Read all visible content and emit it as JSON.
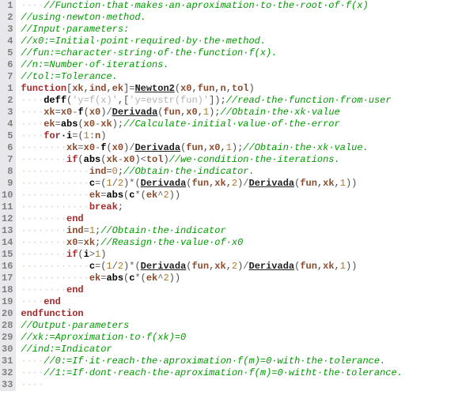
{
  "gutter": [
    "1",
    "2",
    "3",
    "4",
    "5",
    "6",
    "7",
    "1",
    "2",
    "3",
    "4",
    "5",
    "6",
    "7",
    "8",
    "9",
    "10",
    "11",
    "12",
    "13",
    "14",
    "15",
    "16",
    "17",
    "18",
    "19",
    "20",
    "28",
    "29",
    "30",
    "31",
    "32",
    "33"
  ],
  "lines": [
    [
      [
        "ws",
        "····"
      ],
      [
        "c-comment",
        "//Function·that·makes·an·aproximation·to·the·root·of·f(x)"
      ]
    ],
    [
      [
        "c-comment",
        "//using·newton·method."
      ]
    ],
    [
      [
        "c-comment",
        "//Input·parameters:"
      ]
    ],
    [
      [
        "c-comment",
        "//x0:=Initial·point·required·by·the·method."
      ]
    ],
    [
      [
        "c-comment",
        "//fun:=character·string·of·the·function·f(x)."
      ]
    ],
    [
      [
        "c-comment",
        "//n:=Number·of·iterations."
      ]
    ],
    [
      [
        "c-comment",
        "//tol:=Tolerance."
      ]
    ],
    [
      [
        "c-kw",
        "function"
      ],
      [
        "c-punct",
        "["
      ],
      [
        "c-var",
        "xk"
      ],
      [
        "c-punct",
        ","
      ],
      [
        "c-var",
        "ind"
      ],
      [
        "c-punct",
        ","
      ],
      [
        "c-var",
        "ek"
      ],
      [
        "c-punct",
        "]"
      ],
      [
        "c-op",
        "="
      ],
      [
        "c-fn",
        "Newton2"
      ],
      [
        "c-punct",
        "("
      ],
      [
        "c-var",
        "x0"
      ],
      [
        "c-punct",
        ","
      ],
      [
        "c-var",
        "fun"
      ],
      [
        "c-punct",
        ","
      ],
      [
        "c-var",
        "n"
      ],
      [
        "c-punct",
        ","
      ],
      [
        "c-var",
        "tol"
      ],
      [
        "c-punct",
        ")"
      ]
    ],
    [
      [
        "ws",
        "····"
      ],
      [
        "c-id",
        "deff"
      ],
      [
        "c-punct",
        "("
      ],
      [
        "c-str",
        "'y=f(x)'"
      ],
      [
        "c-punct",
        ","
      ],
      [
        "c-punct",
        "["
      ],
      [
        "c-str",
        "'y=evstr(fun)'"
      ],
      [
        "c-punct",
        "]"
      ],
      [
        "c-punct",
        ")"
      ],
      [
        "c-punct",
        ";"
      ],
      [
        "c-comment",
        "//read·the·function·from·user"
      ]
    ],
    [
      [
        "ws",
        "····"
      ],
      [
        "c-var",
        "xk"
      ],
      [
        "c-op",
        "="
      ],
      [
        "c-var",
        "x0"
      ],
      [
        "c-op",
        "-"
      ],
      [
        "c-id",
        "f"
      ],
      [
        "c-punct",
        "("
      ],
      [
        "c-var",
        "x0"
      ],
      [
        "c-punct",
        ")"
      ],
      [
        "c-op",
        "/"
      ],
      [
        "c-fn",
        "Derivada"
      ],
      [
        "c-punct",
        "("
      ],
      [
        "c-var",
        "fun"
      ],
      [
        "c-punct",
        ","
      ],
      [
        "c-var",
        "x0"
      ],
      [
        "c-punct",
        ","
      ],
      [
        "c-num",
        "1"
      ],
      [
        "c-punct",
        ")"
      ],
      [
        "c-punct",
        ";"
      ],
      [
        "c-comment",
        "//Obtain·the·xk·value"
      ]
    ],
    [
      [
        "ws",
        "····"
      ],
      [
        "c-var",
        "ek"
      ],
      [
        "c-op",
        "="
      ],
      [
        "c-id",
        "abs"
      ],
      [
        "c-punct",
        "("
      ],
      [
        "c-var",
        "x0"
      ],
      [
        "c-op",
        "-"
      ],
      [
        "c-var",
        "xk"
      ],
      [
        "c-punct",
        ")"
      ],
      [
        "c-punct",
        ";"
      ],
      [
        "c-comment",
        "//Calculate·initial·value·of·the·error"
      ]
    ],
    [
      [
        "ws",
        "····"
      ],
      [
        "c-kw",
        "for"
      ],
      [
        "c-id",
        "·i"
      ],
      [
        "c-op",
        "="
      ],
      [
        "c-punct",
        "("
      ],
      [
        "c-num",
        "1"
      ],
      [
        "c-op",
        ":"
      ],
      [
        "c-var",
        "n"
      ],
      [
        "c-punct",
        ")"
      ]
    ],
    [
      [
        "ws",
        "········"
      ],
      [
        "c-var",
        "xk"
      ],
      [
        "c-op",
        "="
      ],
      [
        "c-var",
        "x0"
      ],
      [
        "c-op",
        "-"
      ],
      [
        "c-id",
        "f"
      ],
      [
        "c-punct",
        "("
      ],
      [
        "c-var",
        "x0"
      ],
      [
        "c-punct",
        ")"
      ],
      [
        "c-op",
        "/"
      ],
      [
        "c-fn",
        "Derivada"
      ],
      [
        "c-punct",
        "("
      ],
      [
        "c-var",
        "fun"
      ],
      [
        "c-punct",
        ","
      ],
      [
        "c-var",
        "x0"
      ],
      [
        "c-punct",
        ","
      ],
      [
        "c-num",
        "1"
      ],
      [
        "c-punct",
        ")"
      ],
      [
        "c-punct",
        ";"
      ],
      [
        "c-comment",
        "//Obtain·the·xk·value."
      ]
    ],
    [
      [
        "ws",
        "········"
      ],
      [
        "c-kw",
        "if"
      ],
      [
        "c-punct",
        "("
      ],
      [
        "c-id",
        "abs"
      ],
      [
        "c-punct",
        "("
      ],
      [
        "c-var",
        "xk"
      ],
      [
        "c-op",
        "-"
      ],
      [
        "c-var",
        "x0"
      ],
      [
        "c-punct",
        ")"
      ],
      [
        "c-op",
        "<"
      ],
      [
        "c-var",
        "tol"
      ],
      [
        "c-punct",
        ")"
      ],
      [
        "c-comment",
        "//we·condition·the·iterations."
      ]
    ],
    [
      [
        "ws",
        "············"
      ],
      [
        "c-var",
        "ind"
      ],
      [
        "c-op",
        "="
      ],
      [
        "c-num",
        "0"
      ],
      [
        "c-punct",
        ";"
      ],
      [
        "c-comment",
        "//Obtain·the·indicator."
      ]
    ],
    [
      [
        "ws",
        "············"
      ],
      [
        "c-id",
        "c"
      ],
      [
        "c-op",
        "="
      ],
      [
        "c-punct",
        "("
      ],
      [
        "c-num",
        "1"
      ],
      [
        "c-op",
        "/"
      ],
      [
        "c-num",
        "2"
      ],
      [
        "c-punct",
        ")"
      ],
      [
        "c-op",
        "*"
      ],
      [
        "c-punct",
        "("
      ],
      [
        "c-fn",
        "Derivada"
      ],
      [
        "c-punct",
        "("
      ],
      [
        "c-var",
        "fun"
      ],
      [
        "c-punct",
        ","
      ],
      [
        "c-var",
        "xk"
      ],
      [
        "c-punct",
        ","
      ],
      [
        "c-num",
        "2"
      ],
      [
        "c-punct",
        ")"
      ],
      [
        "c-op",
        "/"
      ],
      [
        "c-fn",
        "Derivada"
      ],
      [
        "c-punct",
        "("
      ],
      [
        "c-var",
        "fun"
      ],
      [
        "c-punct",
        ","
      ],
      [
        "c-var",
        "xk"
      ],
      [
        "c-punct",
        ","
      ],
      [
        "c-num",
        "1"
      ],
      [
        "c-punct",
        ")"
      ],
      [
        "c-punct",
        ")"
      ]
    ],
    [
      [
        "ws",
        "············"
      ],
      [
        "c-var",
        "ek"
      ],
      [
        "c-op",
        "="
      ],
      [
        "c-id",
        "abs"
      ],
      [
        "c-punct",
        "("
      ],
      [
        "c-id",
        "c"
      ],
      [
        "c-op",
        "*"
      ],
      [
        "c-punct",
        "("
      ],
      [
        "c-var",
        "ek"
      ],
      [
        "c-op",
        "^"
      ],
      [
        "c-num",
        "2"
      ],
      [
        "c-punct",
        ")"
      ],
      [
        "c-punct",
        ")"
      ]
    ],
    [
      [
        "ws",
        "············"
      ],
      [
        "c-kw",
        "break"
      ],
      [
        "c-punct",
        ";"
      ]
    ],
    [
      [
        "ws",
        "········"
      ],
      [
        "c-kw",
        "end"
      ]
    ],
    [
      [
        "ws",
        "········"
      ],
      [
        "c-var",
        "ind"
      ],
      [
        "c-op",
        "="
      ],
      [
        "c-num",
        "1"
      ],
      [
        "c-punct",
        ";"
      ],
      [
        "c-comment",
        "//Obtain·the·indicator"
      ]
    ],
    [
      [
        "ws",
        "········"
      ],
      [
        "c-var",
        "x0"
      ],
      [
        "c-op",
        "="
      ],
      [
        "c-var",
        "xk"
      ],
      [
        "c-punct",
        ";"
      ],
      [
        "c-comment",
        "//Reasign·the·value·of·x0"
      ]
    ],
    [
      [
        "ws",
        "········"
      ],
      [
        "c-kw",
        "if"
      ],
      [
        "c-punct",
        "("
      ],
      [
        "c-id",
        "i"
      ],
      [
        "c-op",
        ">"
      ],
      [
        "c-num",
        "1"
      ],
      [
        "c-punct",
        ")"
      ]
    ],
    [
      [
        "ws",
        "············"
      ],
      [
        "c-id",
        "c"
      ],
      [
        "c-op",
        "="
      ],
      [
        "c-punct",
        "("
      ],
      [
        "c-num",
        "1"
      ],
      [
        "c-op",
        "/"
      ],
      [
        "c-num",
        "2"
      ],
      [
        "c-punct",
        ")"
      ],
      [
        "c-op",
        "*"
      ],
      [
        "c-punct",
        "("
      ],
      [
        "c-fn",
        "Derivada"
      ],
      [
        "c-punct",
        "("
      ],
      [
        "c-var",
        "fun"
      ],
      [
        "c-punct",
        ","
      ],
      [
        "c-var",
        "xk"
      ],
      [
        "c-punct",
        ","
      ],
      [
        "c-num",
        "2"
      ],
      [
        "c-punct",
        ")"
      ],
      [
        "c-op",
        "/"
      ],
      [
        "c-fn",
        "Derivada"
      ],
      [
        "c-punct",
        "("
      ],
      [
        "c-var",
        "fun"
      ],
      [
        "c-punct",
        ","
      ],
      [
        "c-var",
        "xk"
      ],
      [
        "c-punct",
        ","
      ],
      [
        "c-num",
        "1"
      ],
      [
        "c-punct",
        ")"
      ],
      [
        "c-punct",
        ")"
      ]
    ],
    [
      [
        "ws",
        "············"
      ],
      [
        "c-var",
        "ek"
      ],
      [
        "c-op",
        "="
      ],
      [
        "c-id",
        "abs"
      ],
      [
        "c-punct",
        "("
      ],
      [
        "c-id",
        "c"
      ],
      [
        "c-op",
        "*"
      ],
      [
        "c-punct",
        "("
      ],
      [
        "c-var",
        "ek"
      ],
      [
        "c-op",
        "^"
      ],
      [
        "c-num",
        "2"
      ],
      [
        "c-punct",
        ")"
      ],
      [
        "c-punct",
        ")"
      ]
    ],
    [
      [
        "ws",
        "········"
      ],
      [
        "c-kw",
        "end"
      ]
    ],
    [
      [
        "ws",
        "····"
      ],
      [
        "c-kw",
        "end"
      ]
    ],
    [
      [
        "c-kw",
        "endfunction"
      ]
    ],
    [
      [
        "c-comment",
        "//Output·parameters"
      ]
    ],
    [
      [
        "c-comment",
        "//xk:=Aproximation·to·f(xk)=0"
      ]
    ],
    [
      [
        "c-comment",
        "//ind:=Indicator"
      ]
    ],
    [
      [
        "ws",
        "····"
      ],
      [
        "c-comment",
        "//0:=If·it·reach·the·aproximation·f(m)=0·with·the·tolerance."
      ]
    ],
    [
      [
        "ws",
        "····"
      ],
      [
        "c-comment",
        "//1:=If·dont·reach·the·aproximation·f(m)=0·witht·the·tolerance."
      ]
    ],
    [
      [
        "ws",
        "····"
      ]
    ]
  ]
}
